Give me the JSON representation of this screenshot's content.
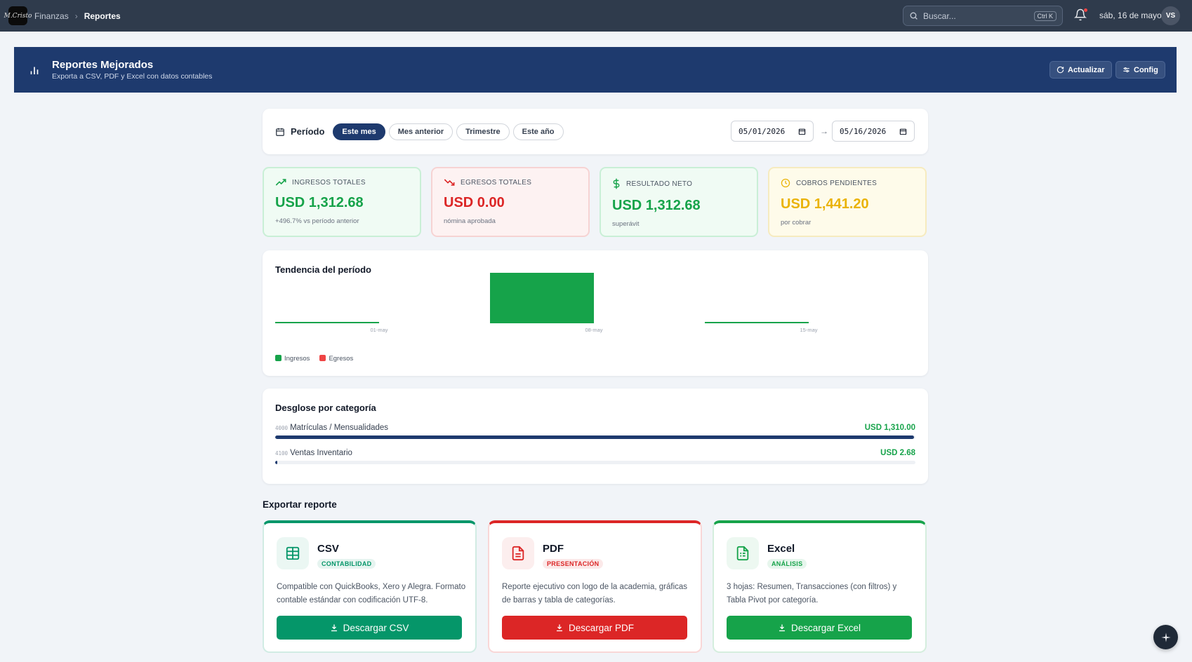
{
  "topbar": {
    "logo_text": "M.Cristo",
    "breadcrumb": [
      "Finanzas",
      "Reportes"
    ],
    "search_placeholder": "Buscar...",
    "search_shortcut": "Ctrl K",
    "date": "sáb, 16 de mayo",
    "avatar_initials": "VS"
  },
  "header": {
    "title": "Reportes Mejorados",
    "subtitle": "Exporta a CSV, PDF y Excel con datos contables",
    "refresh_label": "Actualizar",
    "config_label": "Config"
  },
  "period": {
    "label": "Período",
    "options": [
      "Este mes",
      "Mes anterior",
      "Trimestre",
      "Este año"
    ],
    "selected": "Este mes",
    "start_date": "05/01/2026",
    "end_date": "05/16/2026",
    "arrow": "→"
  },
  "stats": [
    {
      "label": "INGRESOS TOTALES",
      "value": "USD 1,312.68",
      "note": "+496.7% vs período anterior",
      "color": "#16a34a",
      "bg": "#f0fbf4",
      "border": "#c9efd6",
      "icon": "trending-up-icon"
    },
    {
      "label": "EGRESOS TOTALES",
      "value": "USD 0.00",
      "note": "nómina aprobada",
      "color": "#dc2626",
      "bg": "#fdf2f2",
      "border": "#f6d3d3",
      "icon": "trending-down-icon"
    },
    {
      "label": "RESULTADO NETO",
      "value": "USD 1,312.68",
      "note": "superávit",
      "color": "#16a34a",
      "bg": "#f0fbf4",
      "border": "#c9efd6",
      "icon": "dollar-icon"
    },
    {
      "label": "COBROS PENDIENTES",
      "value": "USD 1,441.20",
      "note": "por cobrar",
      "color": "#eab308",
      "bg": "#fefbea",
      "border": "#f6ebbf",
      "icon": "clock-icon"
    }
  ],
  "trend": {
    "title": "Tendencia del período",
    "legend": [
      {
        "name": "Ingresos",
        "color": "#16a34a"
      },
      {
        "name": "Egresos",
        "color": "#ef4444"
      }
    ]
  },
  "chart_data": {
    "type": "bar",
    "title": "Tendencia del período",
    "categories": [
      "01-may",
      "08-may",
      "15-may"
    ],
    "series": [
      {
        "name": "Ingresos",
        "values": [
          0,
          1312.68,
          0
        ],
        "color": "#16a34a"
      },
      {
        "name": "Egresos",
        "values": [
          0,
          0,
          0
        ],
        "color": "#ef4444"
      }
    ],
    "grid": false,
    "legend_position": "bottom-left"
  },
  "breakdown": {
    "title": "Desglose por categoría",
    "rows": [
      {
        "code": "4000",
        "name": "Matrículas / Mensualidades",
        "amount": "USD 1,310.00",
        "share": 0.998
      },
      {
        "code": "4100",
        "name": "Ventas Inventario",
        "amount": "USD 2.68",
        "share": 0.002
      }
    ]
  },
  "export": {
    "title": "Exportar reporte",
    "cards": [
      {
        "format": "CSV",
        "badge": "CONTABILIDAD",
        "description": "Compatible con QuickBooks, Xero y Alegra. Formato contable estándar con codificación UTF-8.",
        "button": "Descargar CSV",
        "color": "#059669",
        "icon": "table-icon"
      },
      {
        "format": "PDF",
        "badge": "PRESENTACIÓN",
        "description": "Reporte ejecutivo con logo de la academia, gráficas de barras y tabla de categorías.",
        "button": "Descargar PDF",
        "color": "#dc2626",
        "icon": "file-text-icon"
      },
      {
        "format": "Excel",
        "badge": "ANÁLISIS",
        "description": "3 hojas: Resumen, Transacciones (con filtros) y Tabla Pivot por categoría.",
        "button": "Descargar Excel",
        "color": "#16a34a",
        "icon": "spreadsheet-icon"
      }
    ]
  }
}
